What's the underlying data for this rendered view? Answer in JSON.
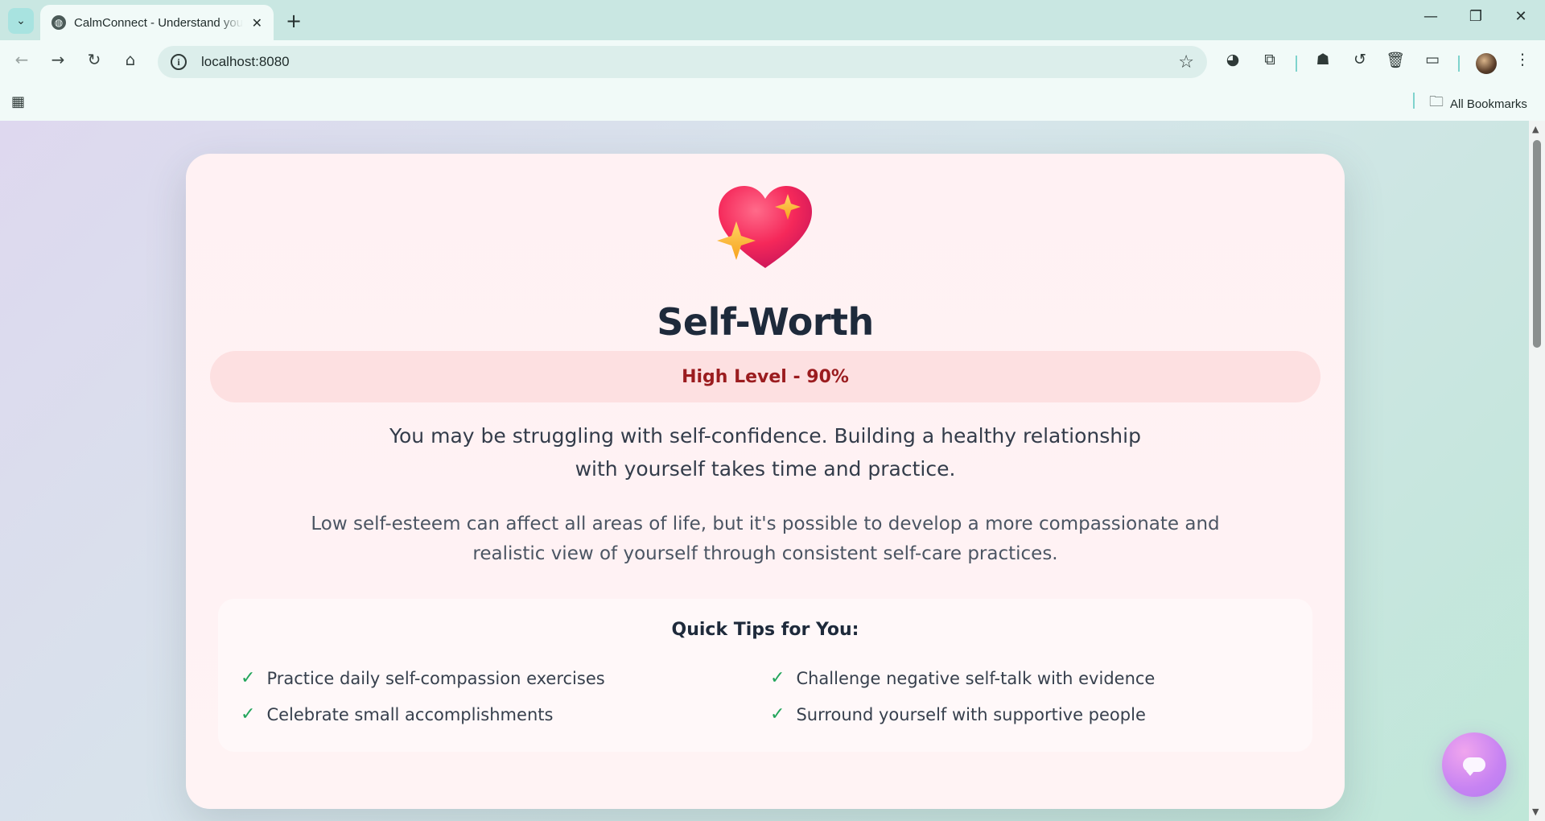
{
  "browser": {
    "tab_title": "CalmConnect - Understand your",
    "url": "localhost:8080",
    "bookmarks_label": "All Bookmarks"
  },
  "page": {
    "title": "Self-Worth",
    "level": "High Level - 90%",
    "level_percent": 90,
    "lead_line1": "You may be struggling with self-confidence. Building a healthy relationship",
    "lead_line2": "with yourself takes time and practice.",
    "desc_line1": "Low self-esteem can affect all areas of life, but it's possible to develop a more compassionate and",
    "desc_line2": "realistic view of yourself through consistent self-care practices.",
    "tips_title": "Quick Tips for You:",
    "tips": [
      "Practice daily self-compassion exercises",
      "Challenge negative self-talk with evidence",
      "Celebrate small accomplishments",
      "Surround yourself with supportive people"
    ]
  },
  "colors": {
    "accent_pill_bg": "#fde0e1",
    "accent_pill_text": "#9b1c1f",
    "check_green": "#22a55b",
    "title_dark": "#1e2a3b"
  },
  "icons": {
    "heart": "sparkling-heart-icon",
    "chat": "chat-bubble-icon"
  }
}
